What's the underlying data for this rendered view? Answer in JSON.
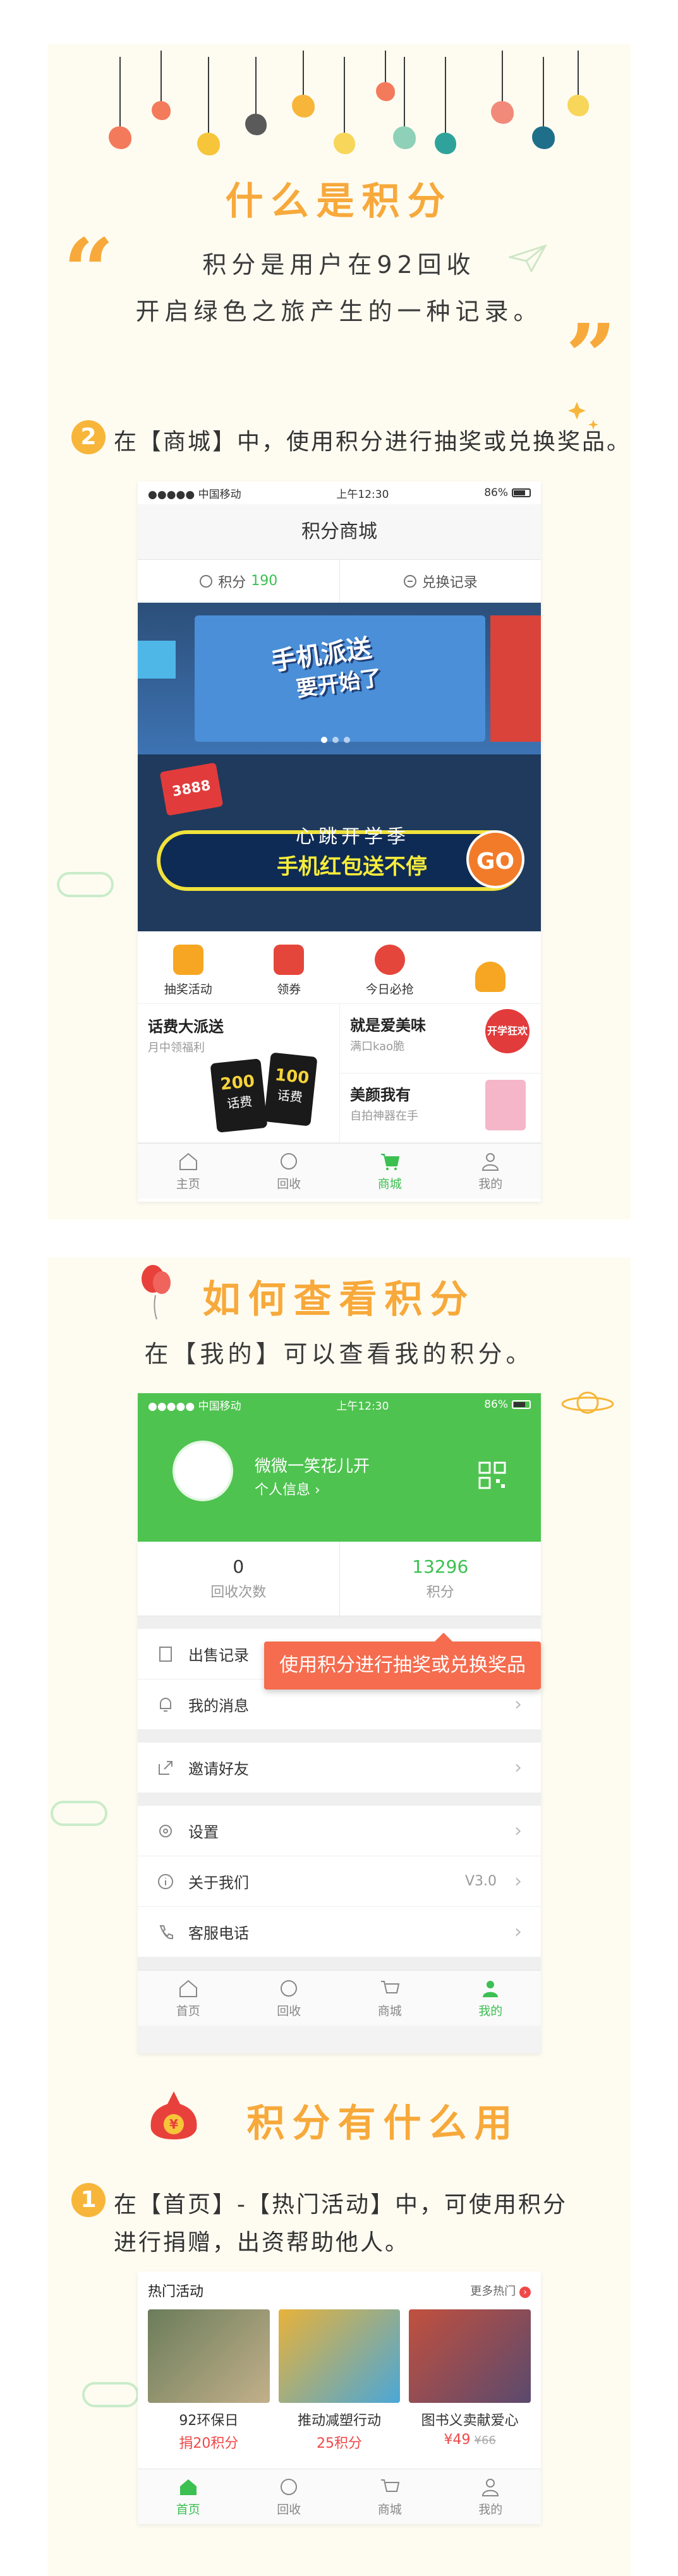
{
  "section1": {
    "title": "什么是积分",
    "line1": "积分是用户在92回收",
    "line2": "开启绿色之旅产生的一种记录。",
    "quote_open": "“",
    "quote_close": "”"
  },
  "step2": {
    "number": "2",
    "text": "在【商城】中，使用积分进行抽奖或兑换奖品。"
  },
  "phone1": {
    "status": {
      "carrier": "●●●●● 中国移动",
      "time": "上午12:30",
      "battery": "86%"
    },
    "title": "积分商城",
    "points_label": "积分",
    "points_value": "190",
    "exchange_label": "兑换记录",
    "banner": {
      "head": "手机派送",
      "sub": "要开始了"
    },
    "promo": {
      "line1": "心跳开学季",
      "line2": "手机红包送不停",
      "go": "GO",
      "badge": "3888"
    },
    "icons": [
      {
        "label": "抽奖活动",
        "icon": "lottery-icon"
      },
      {
        "label": "领券",
        "icon": "coupon-icon"
      },
      {
        "label": "今日必抢",
        "icon": "alarm-icon"
      },
      {
        "label": "",
        "icon": "ufo-icon"
      }
    ],
    "cards": {
      "left": {
        "title": "话费大派送",
        "sub": "月中领福利",
        "badge1": "200",
        "badge1_sub": "话费",
        "badge2": "100",
        "badge2_sub": "话费"
      },
      "right_top": {
        "title": "就是爱美味",
        "sub": "满口kao脆",
        "badge": "开学狂欢"
      },
      "right_bottom": {
        "title": "美颜我有",
        "sub": "自拍神器在手"
      }
    },
    "tabs": [
      {
        "label": "主页",
        "icon": "home-icon"
      },
      {
        "label": "回收",
        "icon": "recycle-icon"
      },
      {
        "label": "商城",
        "icon": "cart-icon"
      },
      {
        "label": "我的",
        "icon": "user-icon"
      }
    ]
  },
  "section2": {
    "title": "如何查看积分",
    "line": "在【我的】可以查看我的积分。"
  },
  "phone2": {
    "status": {
      "carrier": "●●●●● 中国移动",
      "time": "上午12:30",
      "battery": "86%"
    },
    "name": "微微一笑花儿开",
    "info": "个人信息 ›",
    "stats": [
      {
        "value": "0",
        "label": "回收次数"
      },
      {
        "value": "13296",
        "label": "积分"
      }
    ],
    "tooltip": "使用积分进行抽奖或兑换奖品",
    "rows": [
      {
        "label": "出售记录",
        "icon": "receipt-icon"
      },
      {
        "label": "我的消息",
        "icon": "bell-icon"
      },
      {
        "label": "邀请好友",
        "icon": "share-icon"
      },
      {
        "label": "设置",
        "icon": "gear-icon"
      },
      {
        "label": "关于我们",
        "icon": "info-icon",
        "value": "V3.0"
      },
      {
        "label": "客服电话",
        "icon": "phone-icon"
      }
    ],
    "tabs": [
      {
        "label": "首页",
        "icon": "home-icon"
      },
      {
        "label": "回收",
        "icon": "recycle-icon"
      },
      {
        "label": "商城",
        "icon": "cart-icon"
      },
      {
        "label": "我的",
        "icon": "user-icon"
      }
    ]
  },
  "section3": {
    "title": "积分有什么用",
    "coin": "¥"
  },
  "step1": {
    "number": "1",
    "line1": "在【首页】-【热门活动】中，可使用积分",
    "line2": "进行捐赠，出资帮助他人。"
  },
  "phone3": {
    "hot_title": "热门活动",
    "more": "更多热门",
    "items": [
      {
        "title": "92环保日",
        "price": "捐20积分",
        "old": ""
      },
      {
        "title": "推动减塑行动",
        "price": "25积分",
        "old": ""
      },
      {
        "title": "图书义卖献爱心",
        "price": "¥49",
        "old": "¥66"
      }
    ],
    "tabs": [
      {
        "label": "首页",
        "icon": "home-icon"
      },
      {
        "label": "回收",
        "icon": "recycle-icon"
      },
      {
        "label": "商城",
        "icon": "cart-icon"
      },
      {
        "label": "我的",
        "icon": "user-icon"
      }
    ]
  },
  "colors": {
    "accent": "#f7a93b",
    "green": "#3cc051",
    "tooltip": "#f56c4e",
    "cream": "#fefcf1"
  }
}
